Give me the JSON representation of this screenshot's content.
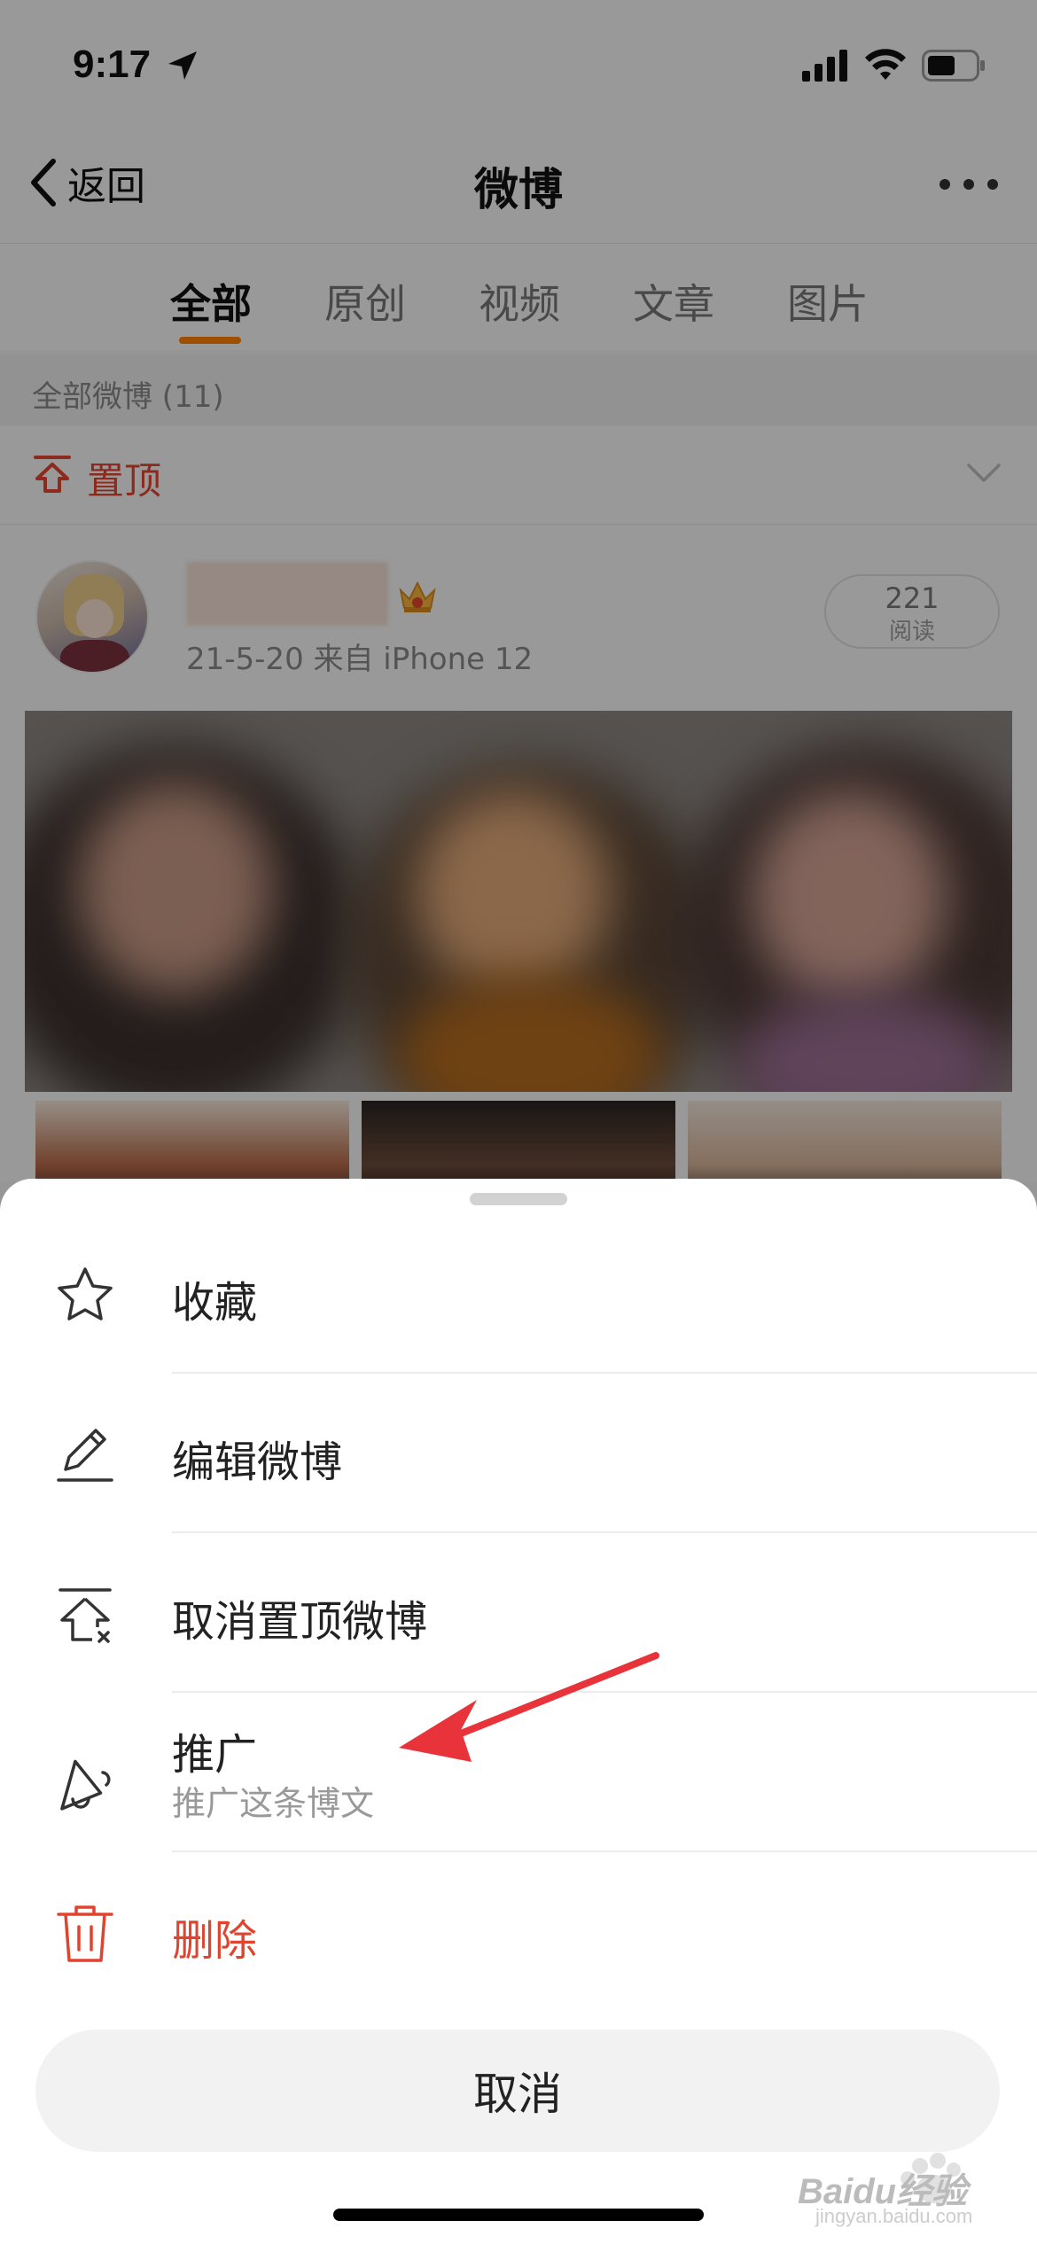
{
  "status_bar": {
    "time": "9:17"
  },
  "nav": {
    "back_label": "返回",
    "title": "微博"
  },
  "tabs": [
    {
      "label": "全部",
      "active": true
    },
    {
      "label": "原创",
      "active": false
    },
    {
      "label": "视频",
      "active": false
    },
    {
      "label": "文章",
      "active": false
    },
    {
      "label": "图片",
      "active": false
    }
  ],
  "section": {
    "header": "全部微博 (11)"
  },
  "pinned": {
    "label": "置顶"
  },
  "post": {
    "meta": "21-5-20  来自 iPhone 12",
    "read_count": "221",
    "read_label": "阅读"
  },
  "sheet": {
    "items": [
      {
        "label": "收藏",
        "icon": "star-icon"
      },
      {
        "label": "编辑微博",
        "icon": "pencil-icon"
      },
      {
        "label": "取消置顶微博",
        "icon": "unpin-icon"
      },
      {
        "label": "推广",
        "sublabel": "推广这条博文",
        "icon": "megaphone-icon"
      },
      {
        "label": "删除",
        "icon": "trash-icon"
      }
    ],
    "cancel_label": "取消"
  },
  "watermark": {
    "brand": "Baidu经验",
    "url": "jingyan.baidu.com"
  },
  "colors": {
    "accent": "#ff8200",
    "danger": "#e0442f",
    "annotation": "#e8333a"
  }
}
